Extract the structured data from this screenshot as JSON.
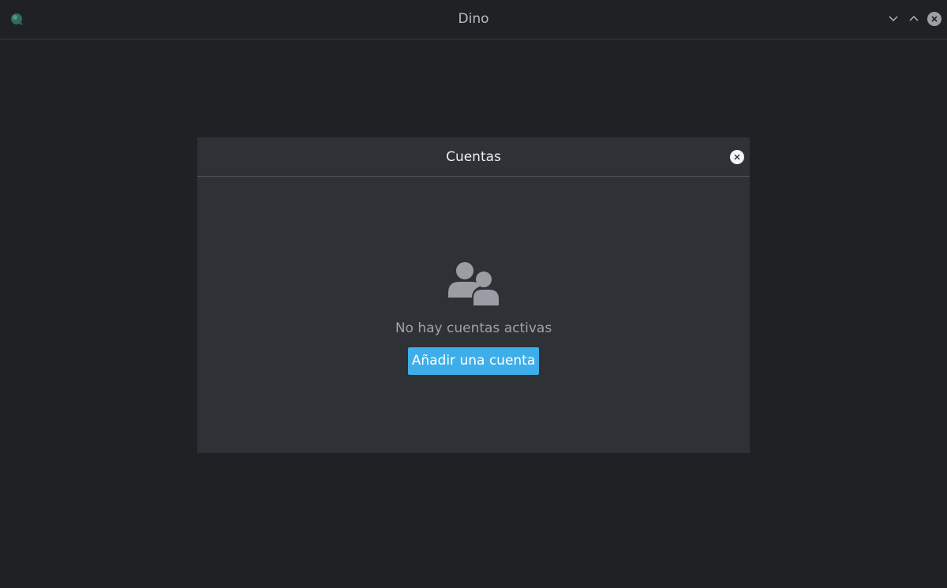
{
  "window": {
    "title": "Dino",
    "icon": "dino-app-icon",
    "controls": [
      "minimize-icon",
      "maximize-icon",
      "close-icon"
    ]
  },
  "dialog": {
    "title": "Cuentas",
    "close_icon": "close-icon",
    "empty_state": {
      "icon": "people-icon",
      "message": "No hay cuentas activas",
      "action_label": "Añadir una cuenta"
    }
  },
  "colors": {
    "background": "#202124",
    "dialog": "#2e3136",
    "accent": "#3daee9"
  }
}
